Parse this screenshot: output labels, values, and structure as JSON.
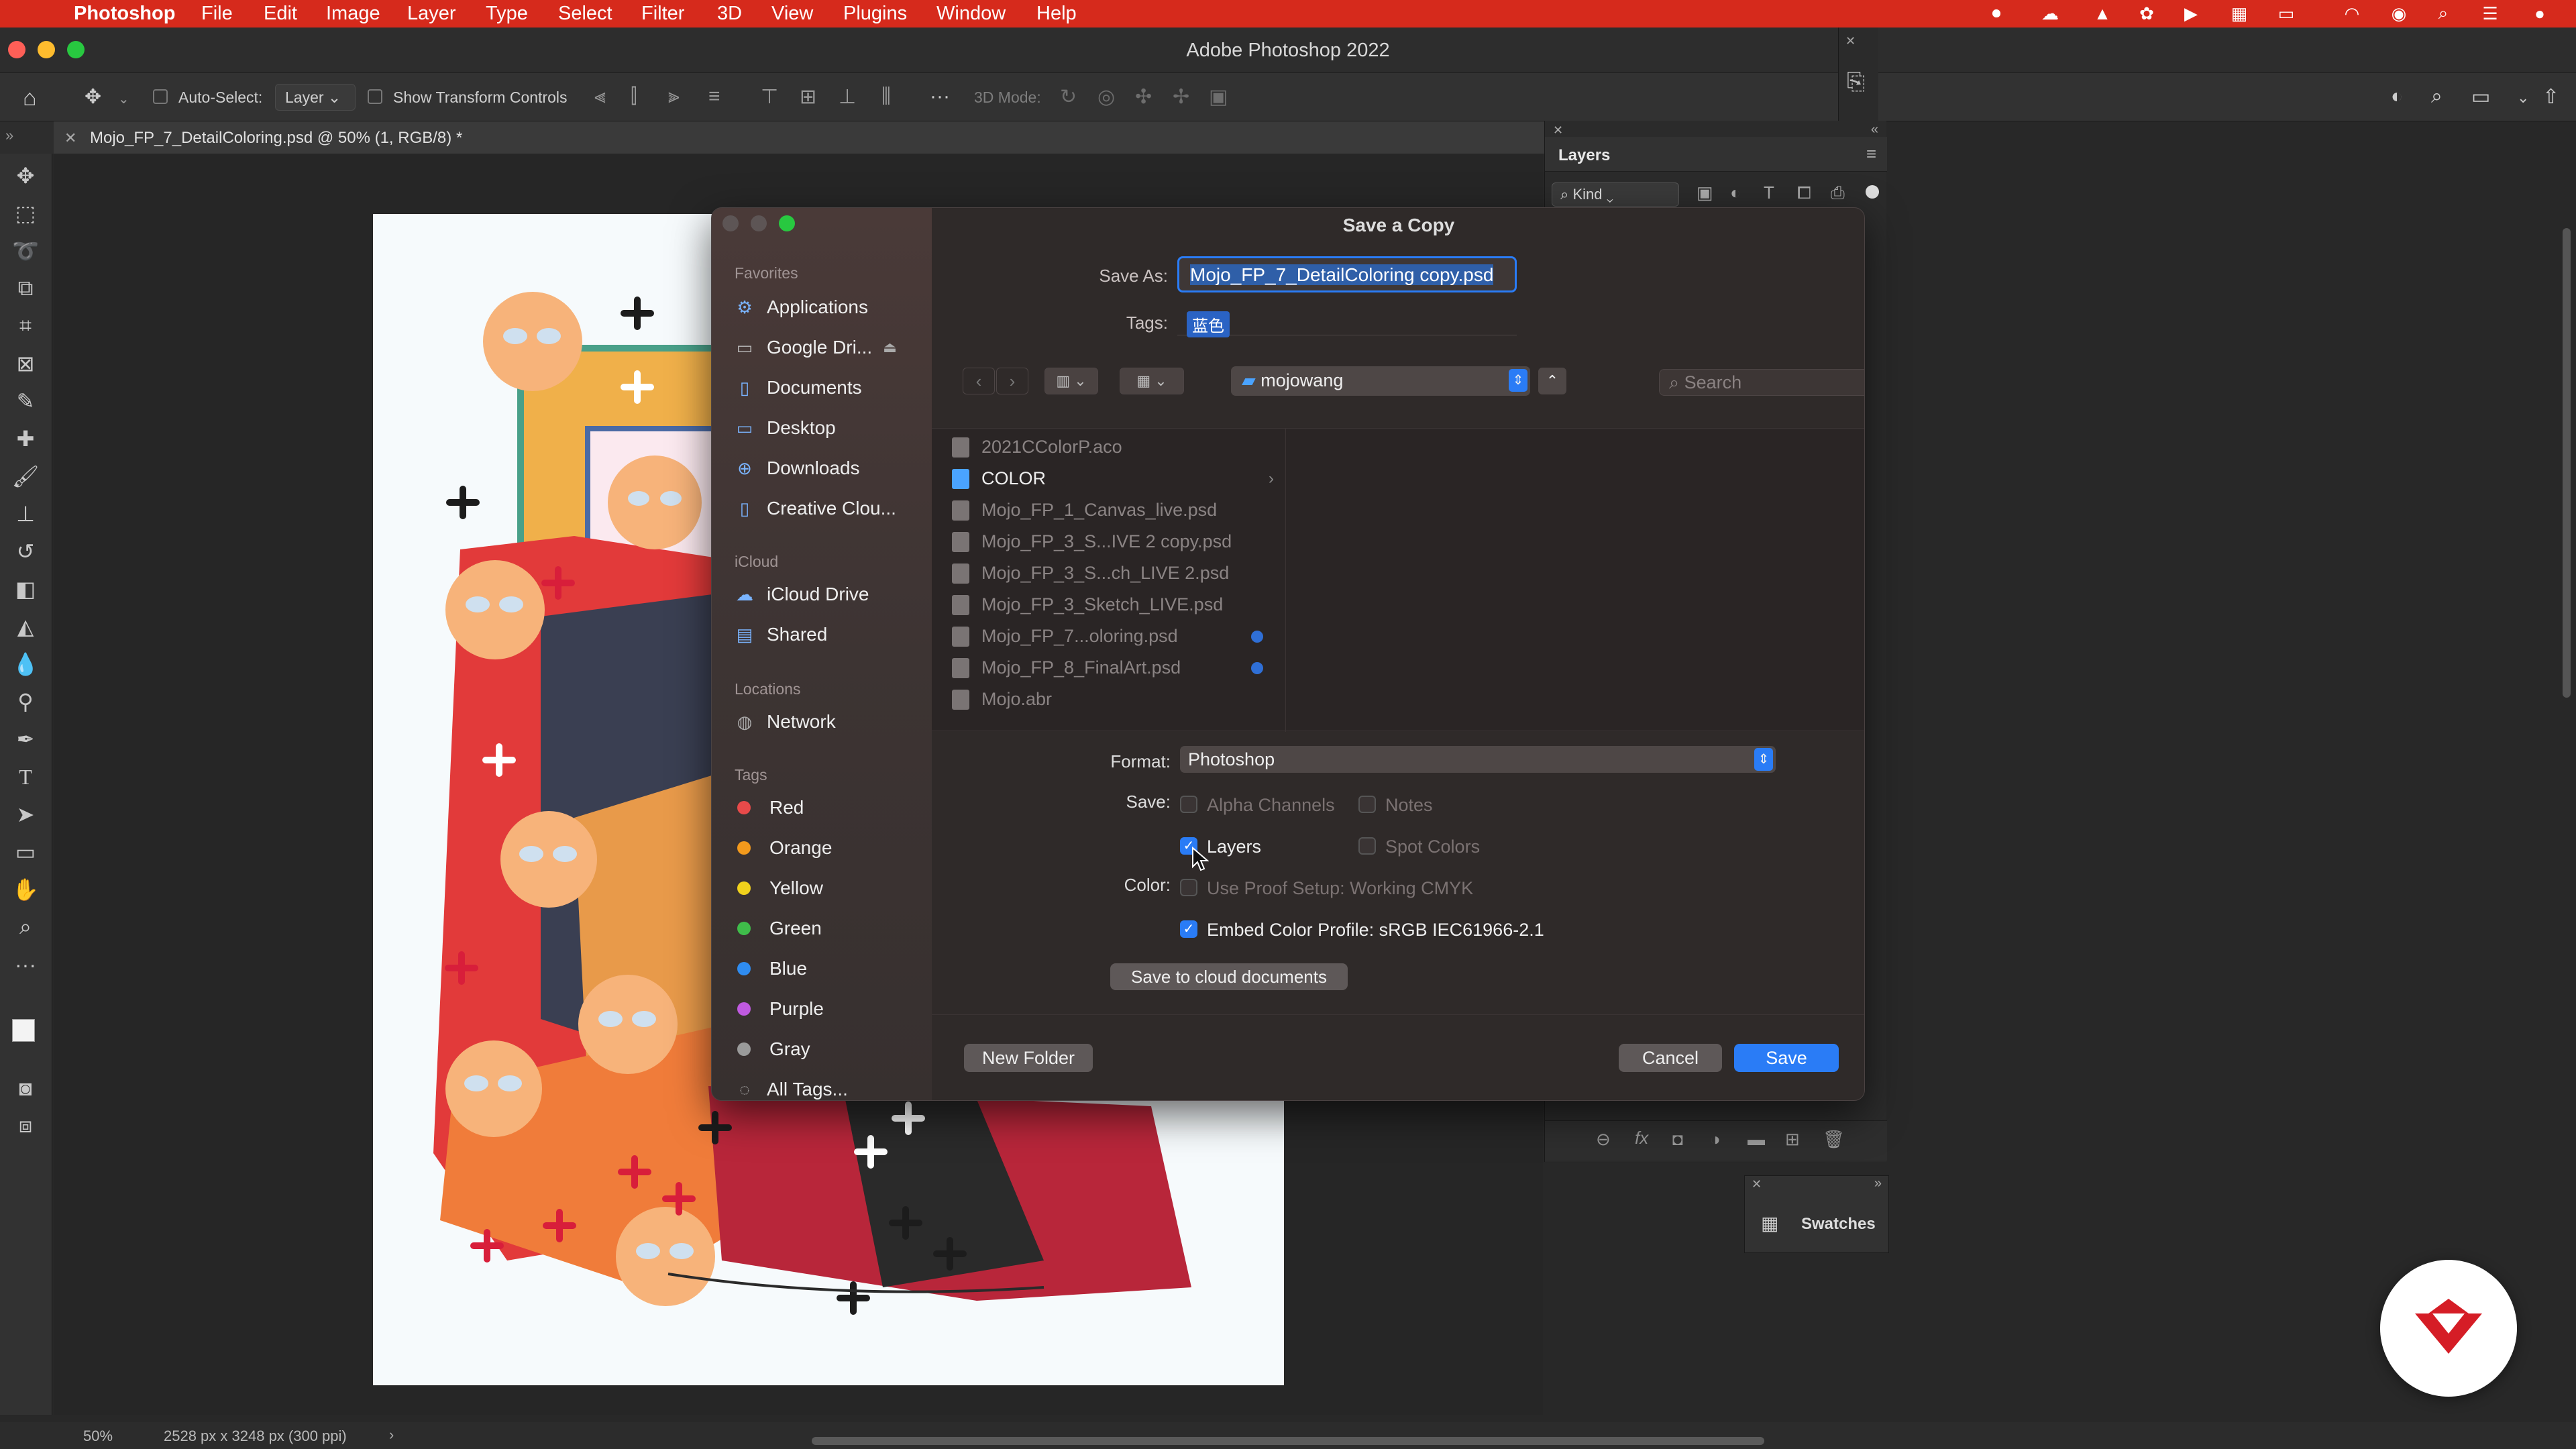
{
  "menubar": {
    "app": "Photoshop",
    "items": [
      "File",
      "Edit",
      "Image",
      "Layer",
      "Type",
      "Select",
      "Filter",
      "3D",
      "View",
      "Plugins",
      "Window",
      "Help"
    ]
  },
  "window": {
    "title": "Adobe Photoshop 2022"
  },
  "options": {
    "auto_select": "Auto-Select:",
    "layer_select": "Layer",
    "show_transform": "Show Transform Controls",
    "mode_3d": "3D Mode:"
  },
  "document": {
    "tab_title": "Mojo_FP_7_DetailColoring.psd @ 50% (1, RGB/8) *"
  },
  "status": {
    "zoom": "50%",
    "dimensions": "2528 px x 3248 px (300 ppi)"
  },
  "layers_panel": {
    "title": "Layers",
    "filter_kind": "Kind"
  },
  "swatches_panel": {
    "title": "Swatches"
  },
  "dialog": {
    "title": "Save a Copy",
    "save_as_label": "Save As:",
    "filename": "Mojo_FP_7_DetailColoring copy.psd",
    "tags_label": "Tags:",
    "tag_value": "蓝色",
    "location": "mojowang",
    "search_placeholder": "Search",
    "sidebar": {
      "favorites_header": "Favorites",
      "favorites": [
        "Applications",
        "Google Dri...",
        "Documents",
        "Desktop",
        "Downloads",
        "Creative Clou..."
      ],
      "icloud_header": "iCloud",
      "icloud": [
        "iCloud Drive",
        "Shared"
      ],
      "locations_header": "Locations",
      "locations": [
        "Network"
      ],
      "tags_header": "Tags",
      "tags": [
        {
          "label": "Red",
          "color": "#e84a4a"
        },
        {
          "label": "Orange",
          "color": "#f39a1c"
        },
        {
          "label": "Yellow",
          "color": "#f1d21c"
        },
        {
          "label": "Green",
          "color": "#3fbd4a"
        },
        {
          "label": "Blue",
          "color": "#2f8cf0"
        },
        {
          "label": "Purple",
          "color": "#c05ae0"
        },
        {
          "label": "Gray",
          "color": "#9a9a9a"
        }
      ],
      "all_tags": "All Tags..."
    },
    "files": [
      {
        "name": "2021CColorP.aco",
        "folder": false,
        "tag": ""
      },
      {
        "name": "COLOR",
        "folder": true,
        "tag": ""
      },
      {
        "name": "Mojo_FP_1_Canvas_live.psd",
        "folder": false,
        "tag": ""
      },
      {
        "name": "Mojo_FP_3_S...IVE 2 copy.psd",
        "folder": false,
        "tag": ""
      },
      {
        "name": "Mojo_FP_3_S...ch_LIVE 2.psd",
        "folder": false,
        "tag": ""
      },
      {
        "name": "Mojo_FP_3_Sketch_LIVE.psd",
        "folder": false,
        "tag": ""
      },
      {
        "name": "Mojo_FP_7...oloring.psd",
        "folder": false,
        "tag": "#2f6fd6"
      },
      {
        "name": "Mojo_FP_8_FinalArt.psd",
        "folder": false,
        "tag": "#2f6fd6"
      },
      {
        "name": "Mojo.abr",
        "folder": false,
        "tag": ""
      }
    ],
    "format_label": "Format:",
    "format_value": "Photoshop",
    "save_label": "Save:",
    "color_label": "Color:",
    "options": {
      "alpha_channels": "Alpha Channels",
      "notes": "Notes",
      "layers": "Layers",
      "spot_colors": "Spot Colors",
      "use_proof": "Use Proof Setup:  Working CMYK",
      "embed_profile": "Embed Color Profile:  sRGB IEC61966-2.1"
    },
    "cloud_button": "Save to cloud documents",
    "new_folder_button": "New Folder",
    "cancel_button": "Cancel",
    "save_button": "Save"
  },
  "colors": {
    "menubar": "#d62a1c",
    "accent": "#2a7cf6"
  }
}
